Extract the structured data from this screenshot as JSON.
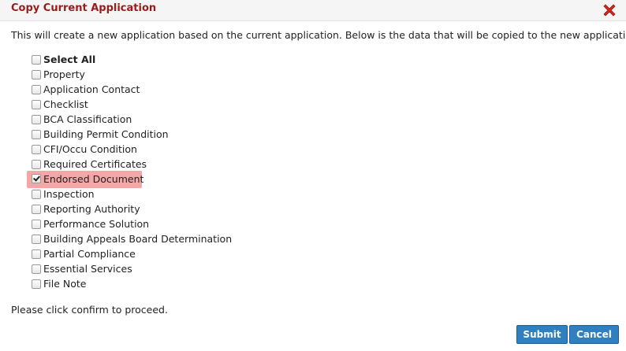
{
  "dialog": {
    "title": "Copy Current Application",
    "close_icon": "close-icon",
    "accent_color": "#9b1b1b",
    "intro_text": "This will create a new application based on the current application. Below is the data that will be copied to the new application:",
    "options": [
      {
        "label": "Select All",
        "checked": false,
        "bold": true
      },
      {
        "label": "Property",
        "checked": false
      },
      {
        "label": "Application Contact",
        "checked": false
      },
      {
        "label": "Checklist",
        "checked": false
      },
      {
        "label": "BCA Classification",
        "checked": false
      },
      {
        "label": "Building Permit Condition",
        "checked": false
      },
      {
        "label": "CFI/Occu Condition",
        "checked": false
      },
      {
        "label": "Required Certificates",
        "checked": false
      },
      {
        "label": "Endorsed Document",
        "checked": true,
        "highlighted": true
      },
      {
        "label": "Inspection",
        "checked": false
      },
      {
        "label": "Reporting Authority",
        "checked": false
      },
      {
        "label": "Performance Solution",
        "checked": false
      },
      {
        "label": "Building Appeals Board Determination",
        "checked": false
      },
      {
        "label": "Partial Compliance",
        "checked": false
      },
      {
        "label": "Essential Services",
        "checked": false
      },
      {
        "label": "File Note",
        "checked": false
      }
    ],
    "footer_text": "Please click confirm to proceed.",
    "submit_label": "Submit",
    "cancel_label": "Cancel",
    "button_color": "#2f7fc1",
    "highlight_color": "#f4a7a7"
  }
}
